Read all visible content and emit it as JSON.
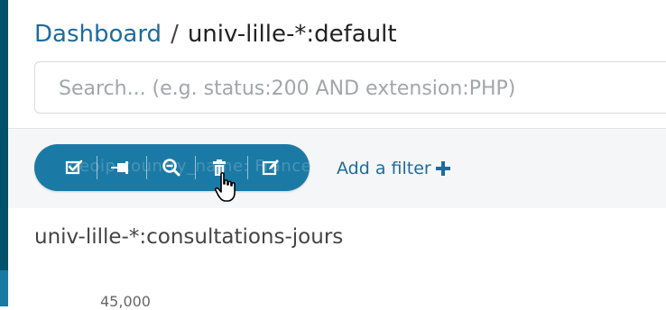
{
  "breadcrumb": {
    "dashboard_label": "Dashboard",
    "separator": "/",
    "current": "univ-lille-*:default"
  },
  "search": {
    "placeholder": "Search... (e.g. status:200 AND extension:PHP)",
    "value": ""
  },
  "filter_bar": {
    "pill_text": "geoip.country_name: France",
    "actions": [
      {
        "name": "toggle-filter",
        "icon": "checkbox-icon"
      },
      {
        "name": "pin-filter",
        "icon": "pin-icon"
      },
      {
        "name": "invert-filter",
        "icon": "magnify-minus-icon"
      },
      {
        "name": "remove-filter",
        "icon": "trash-icon"
      },
      {
        "name": "edit-filter",
        "icon": "edit-icon"
      }
    ],
    "add_filter_label": "Add a filter"
  },
  "panel": {
    "title": "univ-lille-*:consultations-jours",
    "y_tick": "45,000"
  },
  "colors": {
    "accent": "#1f6b9e",
    "pill_bg": "#1b7aa5",
    "sidebar_dark": "#00516b"
  }
}
